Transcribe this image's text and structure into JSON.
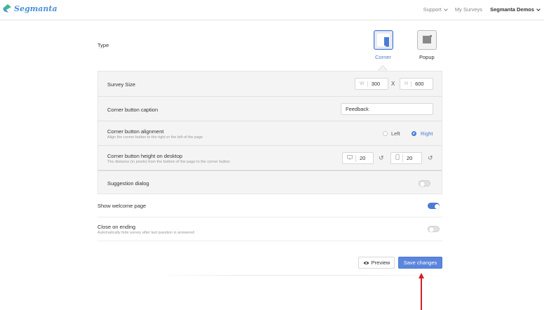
{
  "header": {
    "brand": "Segmanta",
    "nav": [
      {
        "label": "Support",
        "has_chevron": true
      },
      {
        "label": "My Surveys",
        "has_chevron": false
      },
      {
        "label": "Segmanta Demos",
        "has_chevron": true
      }
    ]
  },
  "type": {
    "label": "Type",
    "options": [
      {
        "label": "Corner",
        "selected": true,
        "icon": "corner-layout-icon"
      },
      {
        "label": "Popup",
        "selected": false,
        "icon": "popup-layout-icon"
      }
    ]
  },
  "settings": {
    "survey_size": {
      "label": "Survey Size",
      "width_prefix": "W",
      "width_value": "300",
      "separator": "X",
      "height_prefix": "H",
      "height_value": "600"
    },
    "corner_caption": {
      "label": "Corner button caption",
      "value": "Feedback"
    },
    "corner_alignment": {
      "label": "Corner button alignment",
      "description": "Align the corner button to the right or the left of the page",
      "options": [
        {
          "label": "Left",
          "selected": false
        },
        {
          "label": "Right",
          "selected": true
        }
      ]
    },
    "corner_height": {
      "label": "Corner button height on desktop",
      "description": "The distance (in pixels) from the bottom of the page to the corner button",
      "desktop_value": "20",
      "mobile_value": "20"
    },
    "suggestion_dialog": {
      "label": "Suggestion dialog",
      "enabled": false
    }
  },
  "welcome_page": {
    "label": "Show welcome page",
    "enabled": true
  },
  "close_on_ending": {
    "label": "Close on ending",
    "description": "Automatically hide survey after last question is answered",
    "enabled": false
  },
  "actions": {
    "preview_label": "Preview",
    "save_label": "Save changes"
  },
  "colors": {
    "accent": "#5b86dc",
    "annotation_arrow": "#d0202a"
  }
}
